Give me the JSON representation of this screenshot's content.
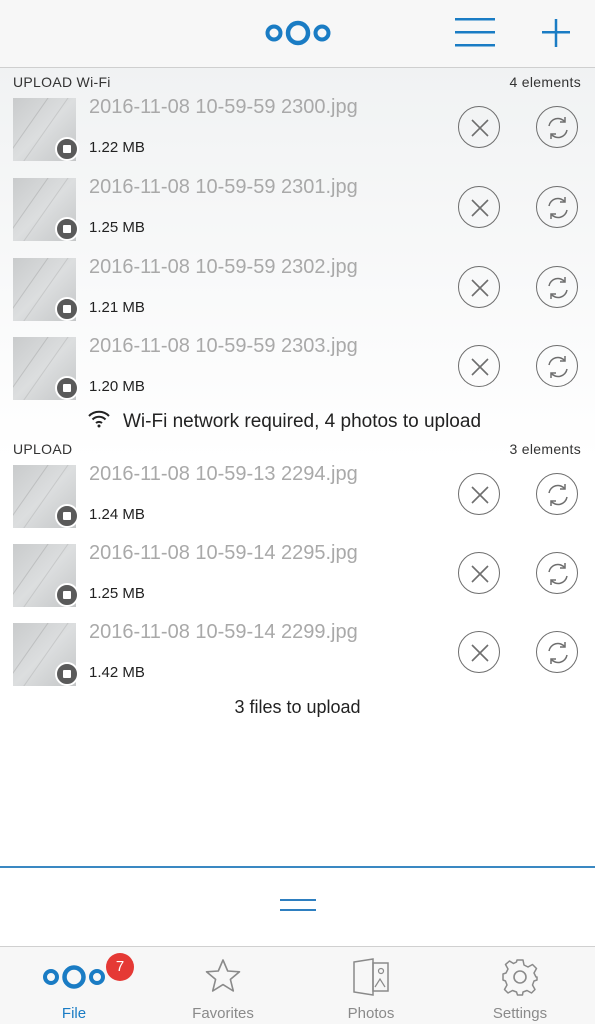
{
  "header": {
    "logo_icon": "nextcloud-logo-icon",
    "menu_icon": "hamburger-menu-icon",
    "add_icon": "plus-icon",
    "accent": "#1a7cc4"
  },
  "wifi_section": {
    "title": "UPLOAD Wi-Fi",
    "count": "4 elements",
    "items": [
      {
        "name": "2016-11-08 10-59-59 2300.jpg",
        "size": "1.22 MB"
      },
      {
        "name": "2016-11-08 10-59-59 2301.jpg",
        "size": "1.25 MB"
      },
      {
        "name": "2016-11-08 10-59-59 2302.jpg",
        "size": "1.21 MB"
      },
      {
        "name": "2016-11-08 10-59-59 2303.jpg",
        "size": "1.20 MB"
      }
    ],
    "status": "Wi-Fi network required, 4 photos to upload"
  },
  "upload_section": {
    "title": "UPLOAD",
    "count": "3 elements",
    "items": [
      {
        "name": "2016-11-08 10-59-13 2294.jpg",
        "size": "1.24 MB"
      },
      {
        "name": "2016-11-08 10-59-14 2295.jpg",
        "size": "1.25 MB"
      },
      {
        "name": "2016-11-08 10-59-14 2299.jpg",
        "size": "1.42 MB"
      }
    ],
    "status": "3 files to upload"
  },
  "tabs": [
    {
      "label": "File",
      "icon": "nextcloud-logo-icon",
      "badge": "7",
      "active": true
    },
    {
      "label": "Favorites",
      "icon": "star-icon"
    },
    {
      "label": "Photos",
      "icon": "photos-icon"
    },
    {
      "label": "Settings",
      "icon": "gear-icon"
    }
  ],
  "colors": {
    "accent": "#1a7cc4",
    "badge": "#e53935"
  }
}
